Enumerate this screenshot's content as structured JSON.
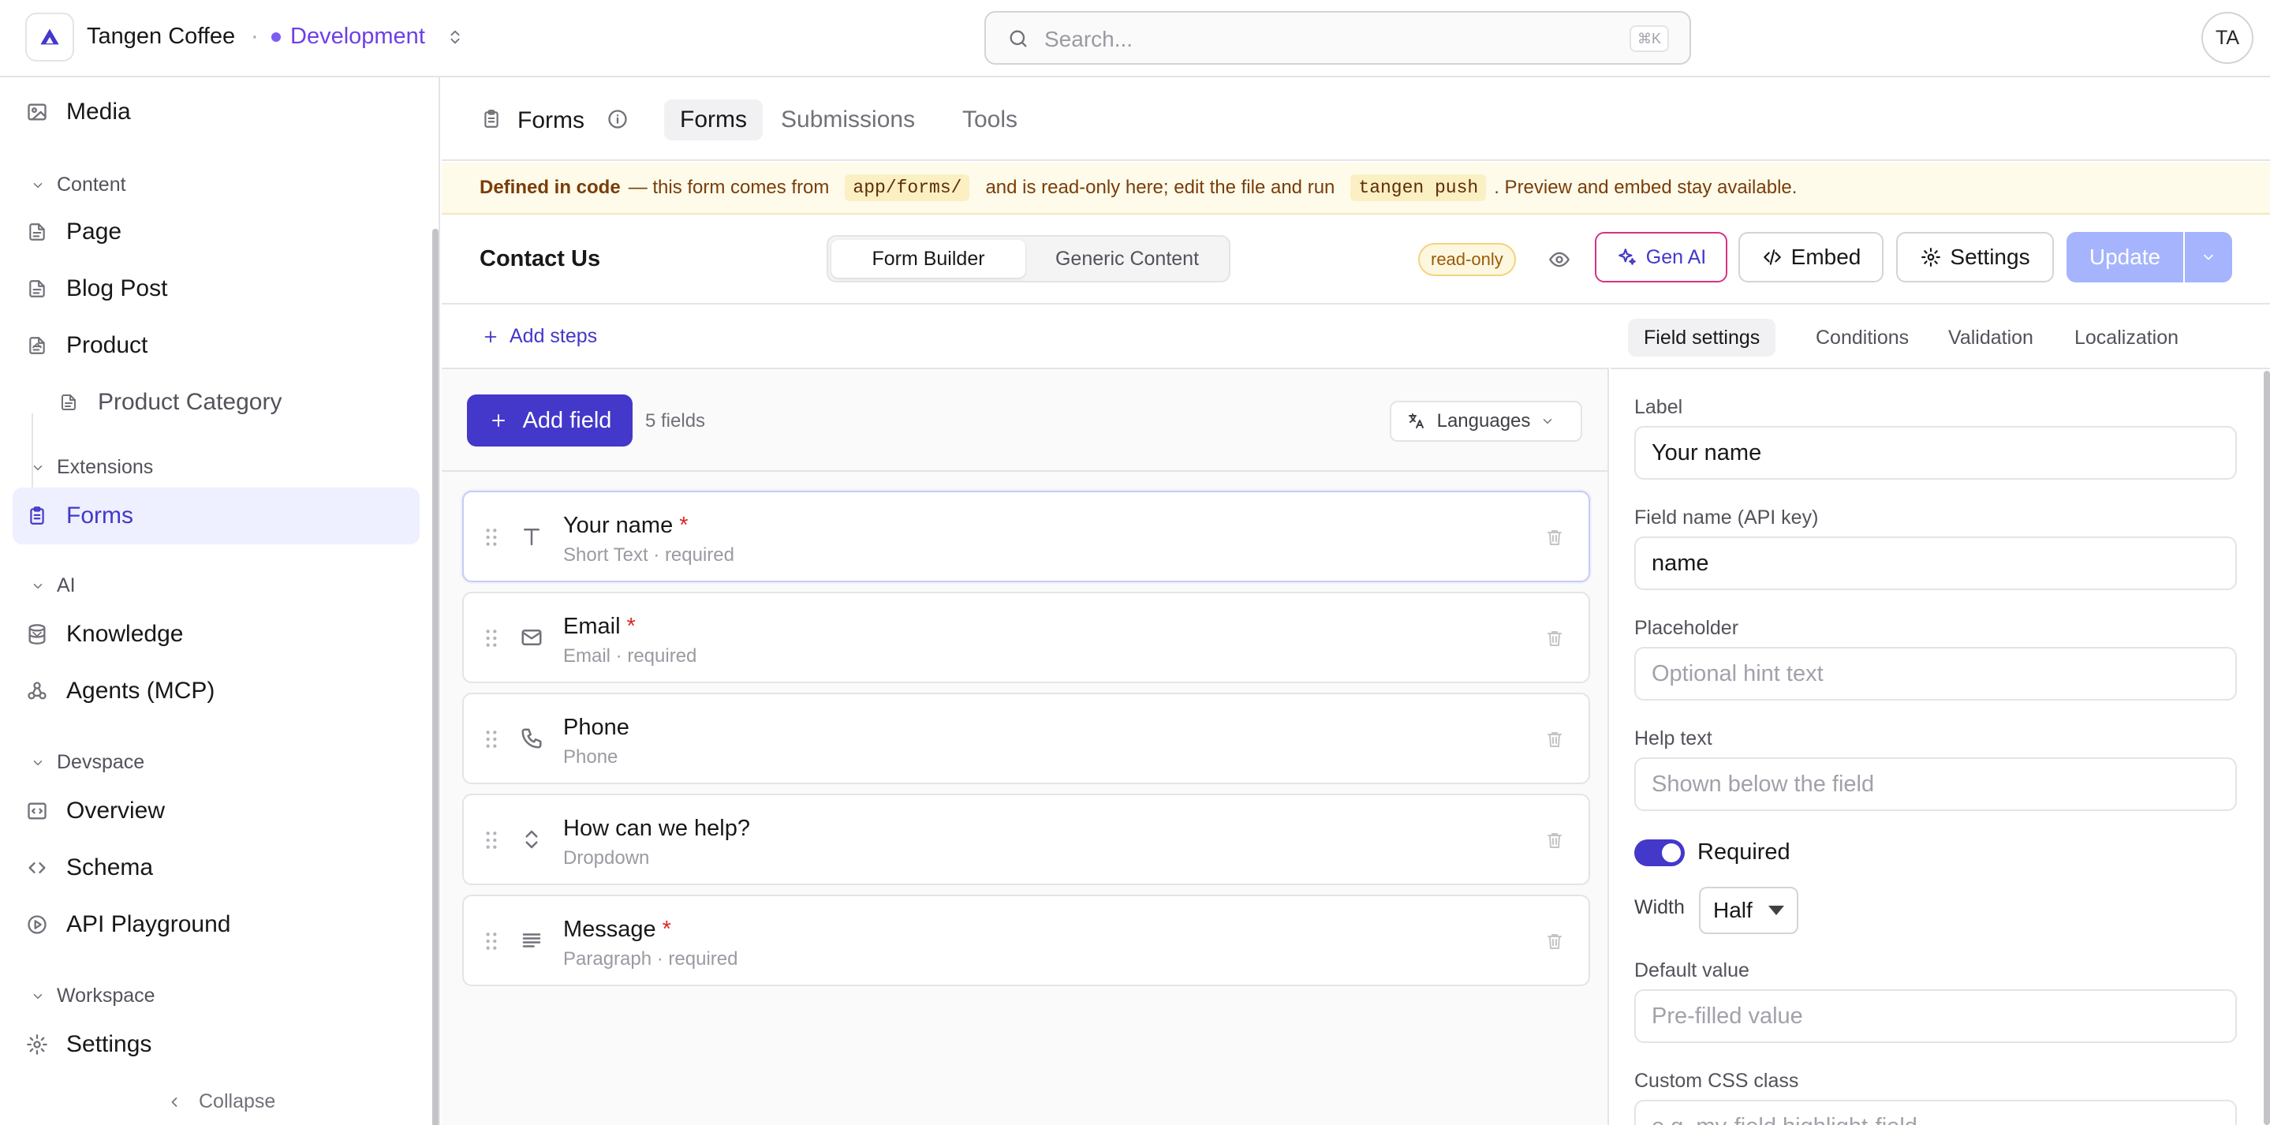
{
  "topbar": {
    "org_name": "Tangen Coffee",
    "separator": "·",
    "environment": "Development",
    "search_placeholder": "Search...",
    "search_shortcut": "⌘K",
    "avatar_initials": "TA"
  },
  "sidebar": {
    "items": {
      "media": "Media",
      "page": "Page",
      "blog_post": "Blog Post",
      "product": "Product",
      "product_category": "Product Category",
      "forms": "Forms",
      "knowledge": "Knowledge",
      "agents": "Agents (MCP)",
      "overview": "Overview",
      "schema": "Schema",
      "api_playground": "API Playground",
      "settings": "Settings"
    },
    "groups": {
      "content": "Content",
      "extensions": "Extensions",
      "ai": "AI",
      "devspace": "Devspace",
      "workspace": "Workspace"
    },
    "collapse_label": "Collapse",
    "active_item": "Forms"
  },
  "header": {
    "title": "Forms",
    "tabs": [
      "Forms",
      "Submissions",
      "Tools"
    ],
    "active_tab": "Forms"
  },
  "banner": {
    "strong": "Defined in code",
    "text1": "— this form comes from",
    "code1": "app/forms/",
    "text2": "and is read-only here; edit the file and run",
    "code2": "tangen push",
    "text3": ". Preview and embed stay available."
  },
  "form": {
    "title": "Contact Us",
    "mode_tabs": [
      "Form Builder",
      "Generic Content"
    ],
    "active_mode": "Form Builder",
    "status_badge": "read-only",
    "buttons": {
      "gen_ai": "Gen AI",
      "embed": "Embed",
      "settings": "Settings",
      "update": "Update"
    }
  },
  "builder": {
    "add_steps": "Add steps",
    "add_field": "Add field",
    "fields_count": "5 fields",
    "languages": "Languages",
    "fields": [
      {
        "name": "Your name",
        "required": true,
        "type_line": "Short Text · required",
        "icon": "text-type-icon",
        "selected": true
      },
      {
        "name": "Email",
        "required": true,
        "type_line": "Email · required",
        "icon": "mail-icon",
        "selected": false
      },
      {
        "name": "Phone",
        "required": false,
        "type_line": "Phone",
        "icon": "phone-icon",
        "selected": false
      },
      {
        "name": "How can we help?",
        "required": false,
        "type_line": "Dropdown",
        "icon": "dropdown-icon",
        "selected": false
      },
      {
        "name": "Message",
        "required": true,
        "type_line": "Paragraph · required",
        "icon": "paragraph-icon",
        "selected": false
      }
    ],
    "required_marker": "*"
  },
  "panel": {
    "tabs": [
      "Field settings",
      "Conditions",
      "Validation",
      "Localization"
    ],
    "active_tab": "Field settings",
    "label_label": "Label",
    "label_value": "Your name",
    "api_key_label": "Field name (API key)",
    "api_key_value": "name",
    "placeholder_label": "Placeholder",
    "placeholder_placeholder": "Optional hint text",
    "help_label": "Help text",
    "help_placeholder": "Shown below the field",
    "required_label": "Required",
    "required_on": true,
    "width_label": "Width",
    "width_value": "Half",
    "default_label": "Default value",
    "default_placeholder": "Pre-filled value",
    "css_label": "Custom CSS class",
    "css_placeholder": "e.g. my-field highlight-field"
  },
  "colors": {
    "accent": "#4338ca",
    "environment": "#6d3fe6",
    "banner_bg": "#fefbea",
    "required": "#dc2626",
    "update_disabled": "#a5b4fc"
  }
}
